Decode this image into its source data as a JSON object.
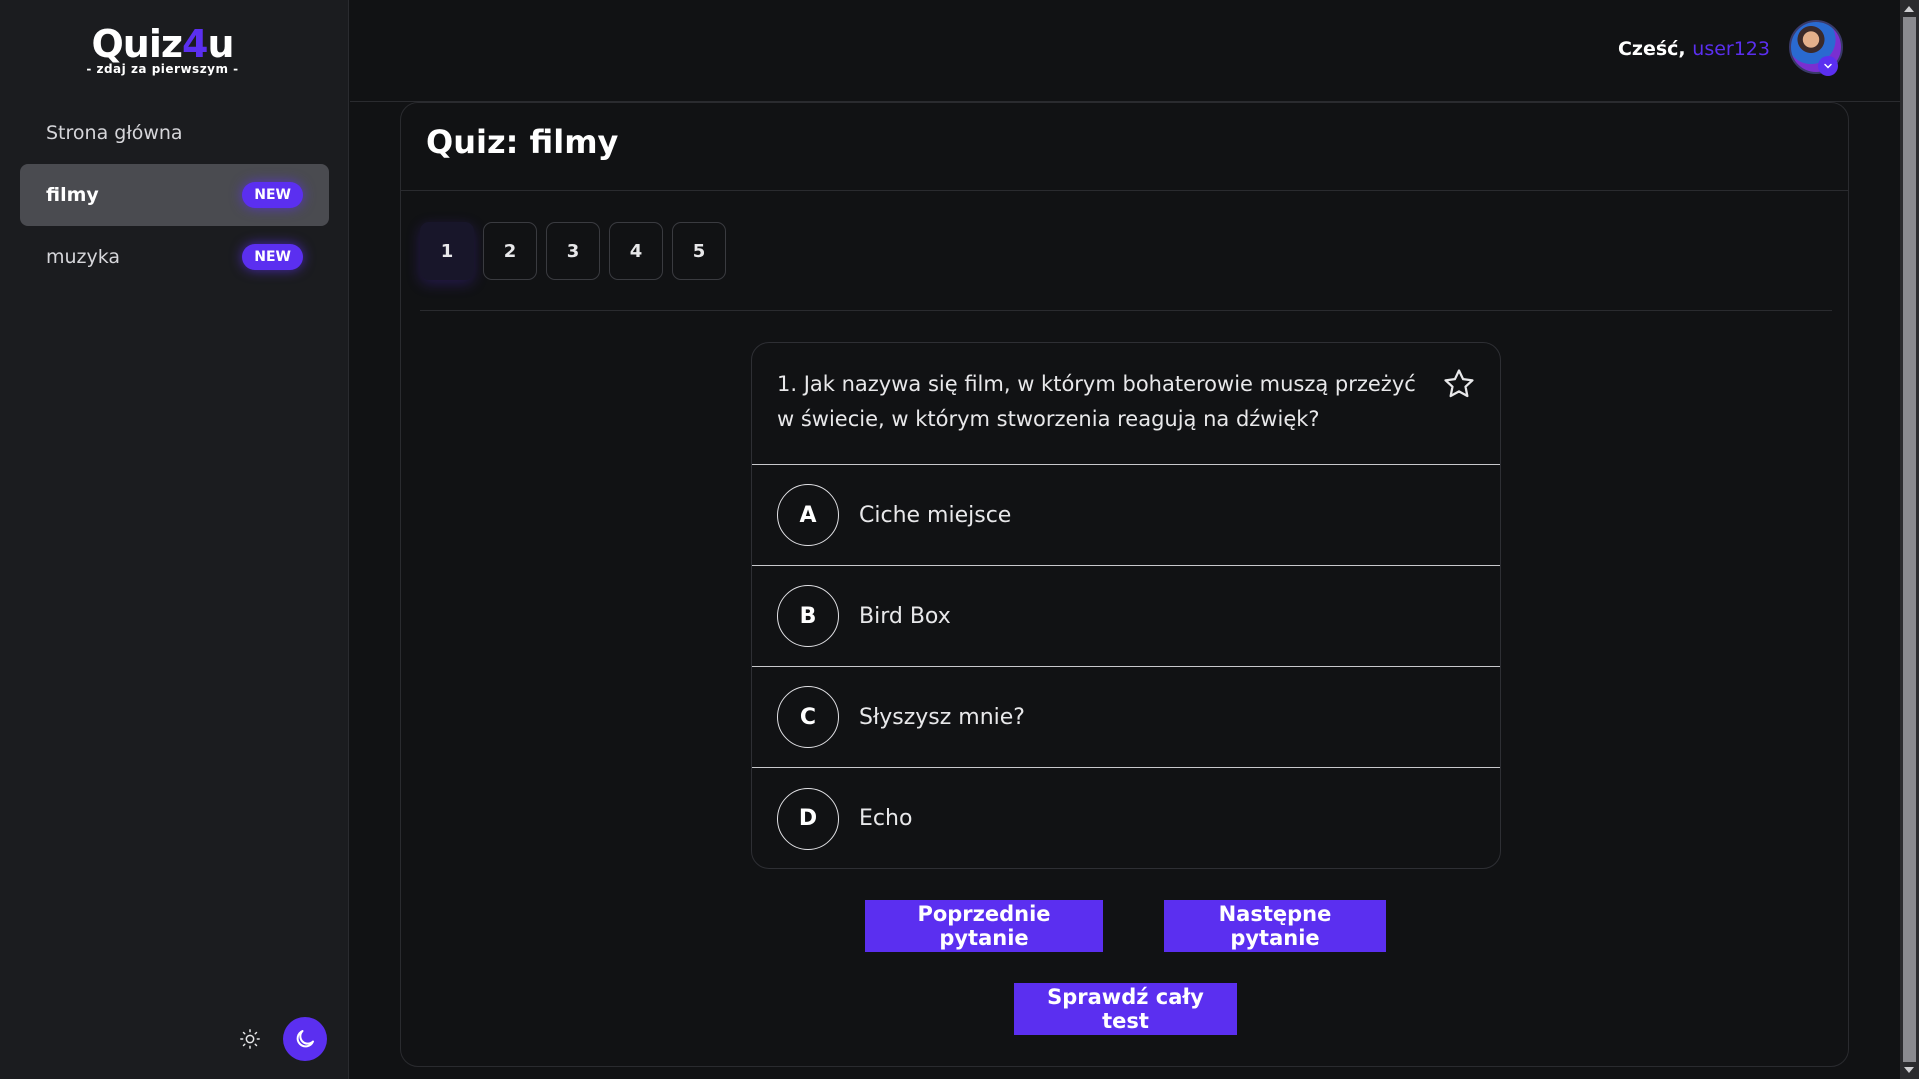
{
  "logo": {
    "main_prefix": "Quiz",
    "main_accent": "4",
    "main_suffix": "u",
    "tagline": "- zdaj za pierwszym -"
  },
  "sidebar": {
    "items": [
      {
        "label": "Strona główna",
        "badge": ""
      },
      {
        "label": "filmy",
        "badge": "NEW"
      },
      {
        "label": "muzyka",
        "badge": "NEW"
      }
    ]
  },
  "header": {
    "greeting": "Cześć,",
    "username": "user123"
  },
  "quiz": {
    "title": "Quiz: filmy",
    "pages": [
      "1",
      "2",
      "3",
      "4",
      "5"
    ],
    "current_page": "1",
    "question": "1. Jak nazywa się film, w którym bohaterowie muszą przeżyć w świecie, w którym stworzenia reagują na dźwięk?",
    "answers": [
      {
        "letter": "A",
        "text": "Ciche miejsce"
      },
      {
        "letter": "B",
        "text": "Bird Box"
      },
      {
        "letter": "C",
        "text": "Słyszysz mnie?"
      },
      {
        "letter": "D",
        "text": "Echo"
      }
    ],
    "prev_label": "Poprzednie pytanie",
    "next_label": "Następne pytanie",
    "check_label": "Sprawdź cały test"
  },
  "icons": {
    "sun": "sun-icon",
    "moon": "moon-icon",
    "star": "star-icon",
    "avatar_chevron": "chevron-down-icon"
  },
  "colors": {
    "accent": "#5b2ff0",
    "background": "#111214",
    "sidebar": "#1b1c1f",
    "active_nav": "#4a4b50"
  }
}
